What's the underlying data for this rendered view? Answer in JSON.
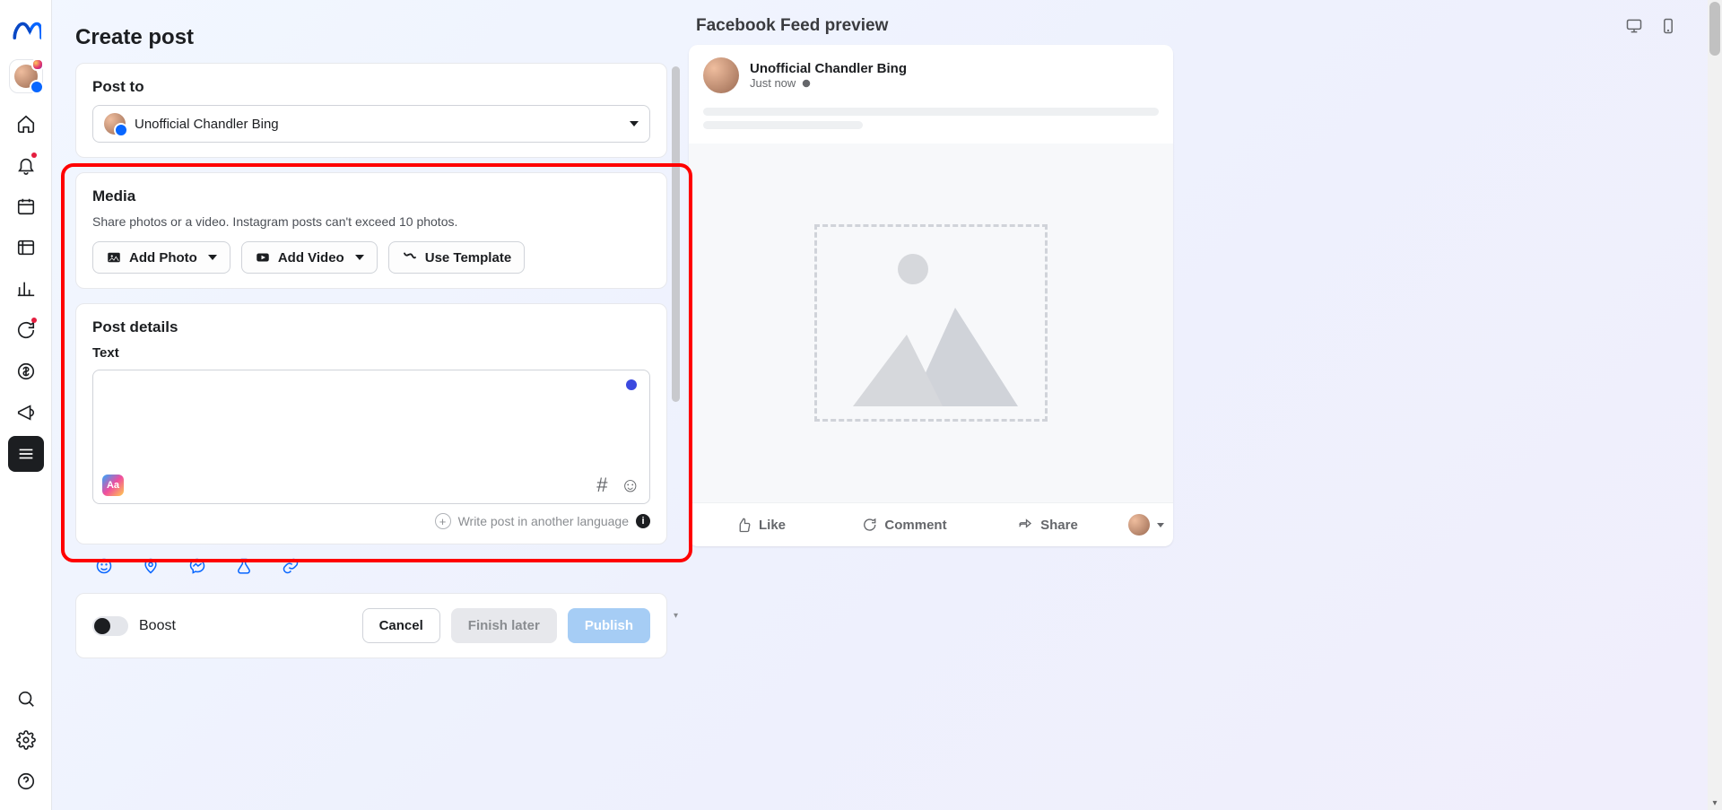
{
  "page_title": "Create post",
  "post_to": {
    "heading": "Post to",
    "selected": "Unofficial Chandler Bing"
  },
  "media": {
    "heading": "Media",
    "help": "Share photos or a video. Instagram posts can't exceed 10 photos.",
    "add_photo": "Add Photo",
    "add_video": "Add Video",
    "use_template": "Use Template"
  },
  "details": {
    "heading": "Post details",
    "text_label": "Text",
    "lang_hint": "Write post in another language"
  },
  "footer": {
    "boost": "Boost",
    "cancel": "Cancel",
    "finish": "Finish later",
    "publish": "Publish"
  },
  "preview": {
    "heading": "Facebook Feed preview",
    "author": "Unofficial Chandler Bing",
    "time": "Just now",
    "like": "Like",
    "comment": "Comment",
    "share": "Share"
  }
}
